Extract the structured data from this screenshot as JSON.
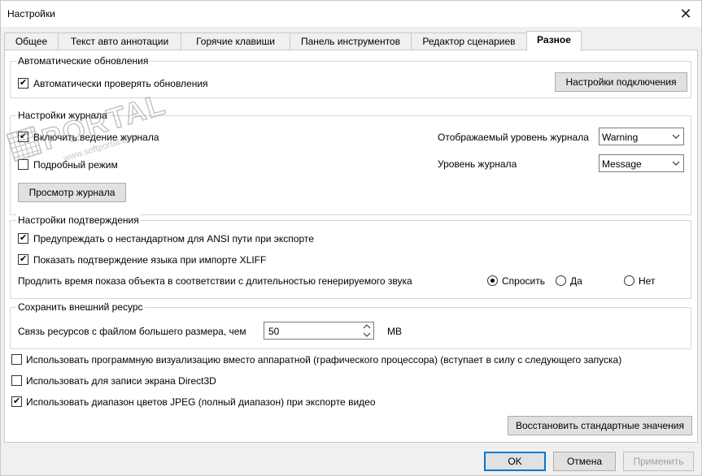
{
  "window": {
    "title": "Настройки",
    "close_icon": "close-icon"
  },
  "watermark": {
    "text": "PORTAL",
    "url": "www.softportal.com"
  },
  "tabs": [
    {
      "label": "Общее"
    },
    {
      "label": "Текст авто аннотации"
    },
    {
      "label": "Горячие клавиши"
    },
    {
      "label": "Панель инструментов"
    },
    {
      "label": "Редактор сценариев"
    },
    {
      "label": "Разное",
      "active": true
    }
  ],
  "auto_updates": {
    "legend": "Автоматические обновления",
    "auto_check": {
      "label": "Автоматически проверять обновления",
      "checked": true
    },
    "connection_button": "Настройки подключения"
  },
  "log": {
    "legend": "Настройки журнала",
    "enable": {
      "label": "Включить ведение журнала",
      "checked": true
    },
    "verbose": {
      "label": "Подробный режим",
      "checked": false
    },
    "view_button": "Просмотр журнала",
    "display_level_label": "Отображаемый уровень журнала",
    "display_level_value": "Warning",
    "level_label": "Уровень журнала",
    "level_value": "Message"
  },
  "confirm": {
    "legend": "Настройки подтверждения",
    "ansi_warn": {
      "label": "Предупреждать о нестандартном для ANSI пути при экспорте",
      "checked": true
    },
    "xliff": {
      "label": "Показать подтверждение языка при импорте XLIFF",
      "checked": true
    },
    "extend_label": "Продлить время показа объекта в соответствии с длительностью генерируемого звука",
    "radio_ask": "Спросить",
    "radio_yes": "Да",
    "radio_no": "Нет",
    "selected": "ask"
  },
  "external": {
    "legend": "Сохранить внешний ресурс",
    "link_label": "Связь ресурсов с файлом большего размера, чем",
    "size_value": "50",
    "unit": "MB"
  },
  "options": {
    "software_render": {
      "label": "Использовать программную визуализацию вместо аппаратной (графического процессора) (вступает в силу с следующего запуска)",
      "checked": false
    },
    "direct3d": {
      "label": "Использовать для записи экрана Direct3D",
      "checked": false
    },
    "jpeg_range": {
      "label": "Использовать диапазон цветов JPEG (полный диапазон) при экспорте видео",
      "checked": true
    }
  },
  "restore_button": "Восстановить стандартные значения",
  "footer": {
    "ok": "OK",
    "cancel": "Отмена",
    "apply": "Применить"
  }
}
